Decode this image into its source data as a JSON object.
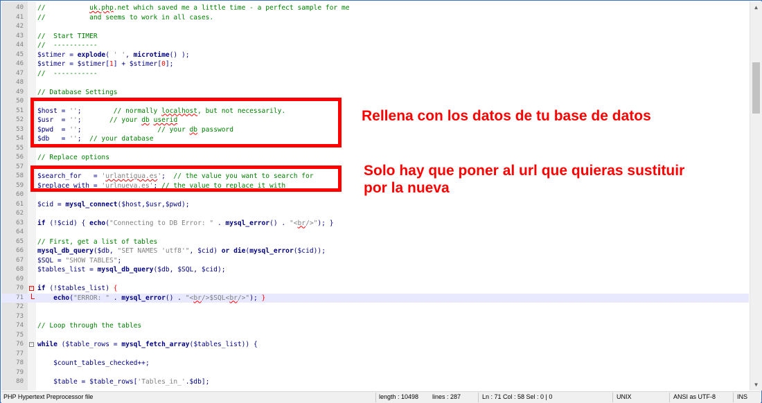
{
  "editor": {
    "lines": [
      {
        "num": "40",
        "parts": [
          [
            "c",
            "//           "
          ],
          [
            "c sq",
            "uk.php"
          ],
          [
            "c",
            ".net which saved me a little time - a perfect sample for me"
          ]
        ]
      },
      {
        "num": "41",
        "parts": [
          [
            "c",
            "//           and seems to work in all cases."
          ]
        ]
      },
      {
        "num": "42",
        "parts": []
      },
      {
        "num": "43",
        "parts": [
          [
            "c",
            "//  Start TIMER"
          ]
        ]
      },
      {
        "num": "44",
        "parts": [
          [
            "c",
            "//  -----------"
          ]
        ]
      },
      {
        "num": "45",
        "parts": [
          [
            "v",
            "$stimer"
          ],
          [
            "o",
            " = "
          ],
          [
            "f",
            "explode"
          ],
          [
            "o",
            "( "
          ],
          [
            "s",
            "' '"
          ],
          [
            "o",
            ", "
          ],
          [
            "f",
            "microtime"
          ],
          [
            "o",
            "() );"
          ]
        ]
      },
      {
        "num": "46",
        "parts": [
          [
            "v",
            "$stimer"
          ],
          [
            "o",
            " = "
          ],
          [
            "v",
            "$stimer"
          ],
          [
            "o",
            "["
          ],
          [
            "n",
            "1"
          ],
          [
            "o",
            "] + "
          ],
          [
            "v",
            "$stimer"
          ],
          [
            "o",
            "["
          ],
          [
            "n",
            "0"
          ],
          [
            "o",
            "];"
          ]
        ]
      },
      {
        "num": "47",
        "parts": [
          [
            "c",
            "//  -----------"
          ]
        ]
      },
      {
        "num": "48",
        "parts": []
      },
      {
        "num": "49",
        "parts": [
          [
            "c",
            "// Database Settings"
          ]
        ]
      },
      {
        "num": "50",
        "parts": []
      },
      {
        "num": "51",
        "parts": [
          [
            "v",
            "$host"
          ],
          [
            "o",
            " = "
          ],
          [
            "s",
            "''"
          ],
          [
            "o",
            ";        "
          ],
          [
            "c",
            "// normally "
          ],
          [
            "c sq",
            "localhost"
          ],
          [
            "c",
            ", but not necessarily."
          ]
        ]
      },
      {
        "num": "52",
        "parts": [
          [
            "v",
            "$usr"
          ],
          [
            "o",
            "  = "
          ],
          [
            "s",
            "''"
          ],
          [
            "o",
            ";       "
          ],
          [
            "c",
            "// your "
          ],
          [
            "c sq",
            "db"
          ],
          [
            "c",
            " "
          ],
          [
            "c sq",
            "userid"
          ]
        ]
      },
      {
        "num": "53",
        "parts": [
          [
            "v",
            "$pwd"
          ],
          [
            "o",
            "  = "
          ],
          [
            "s",
            "''"
          ],
          [
            "o",
            ";                   "
          ],
          [
            "c",
            "// your "
          ],
          [
            "c sq",
            "db"
          ],
          [
            "c",
            " password"
          ]
        ]
      },
      {
        "num": "54",
        "parts": [
          [
            "v",
            "$db"
          ],
          [
            "o",
            "   = "
          ],
          [
            "s",
            "''"
          ],
          [
            "o",
            ";  "
          ],
          [
            "c",
            "// your database"
          ]
        ]
      },
      {
        "num": "55",
        "parts": []
      },
      {
        "num": "56",
        "parts": [
          [
            "c",
            "// Replace options"
          ]
        ]
      },
      {
        "num": "57",
        "parts": []
      },
      {
        "num": "58",
        "parts": [
          [
            "v",
            "$search_for"
          ],
          [
            "o",
            "   = "
          ],
          [
            "s",
            "'"
          ],
          [
            "s sq",
            "urlantigua.es"
          ],
          [
            "s",
            "'"
          ],
          [
            "o",
            ";  "
          ],
          [
            "c",
            "// the value you want to search for"
          ]
        ]
      },
      {
        "num": "59",
        "parts": [
          [
            "v",
            "$replace_with"
          ],
          [
            "o",
            " = "
          ],
          [
            "s",
            "'"
          ],
          [
            "s sq",
            "urlnueva.es"
          ],
          [
            "s",
            "'"
          ],
          [
            "o",
            "; "
          ],
          [
            "c",
            "// the value to replace it with"
          ]
        ]
      },
      {
        "num": "60",
        "parts": []
      },
      {
        "num": "61",
        "parts": [
          [
            "v",
            "$cid"
          ],
          [
            "o",
            " = "
          ],
          [
            "f",
            "mysql_connect"
          ],
          [
            "o",
            "("
          ],
          [
            "v",
            "$host"
          ],
          [
            "o",
            ","
          ],
          [
            "v",
            "$usr"
          ],
          [
            "o",
            ","
          ],
          [
            "v",
            "$pwd"
          ],
          [
            "o",
            ");"
          ]
        ]
      },
      {
        "num": "62",
        "parts": []
      },
      {
        "num": "63",
        "parts": [
          [
            "k",
            "if"
          ],
          [
            "o",
            " (!"
          ],
          [
            "v",
            "$cid"
          ],
          [
            "o",
            ") { "
          ],
          [
            "f",
            "echo"
          ],
          [
            "o",
            "("
          ],
          [
            "s",
            "\"Connecting to DB Error: \""
          ],
          [
            "o",
            " . "
          ],
          [
            "f",
            "mysql_error"
          ],
          [
            "o",
            "() . "
          ],
          [
            "s",
            "\"<"
          ],
          [
            "s sq",
            "br"
          ],
          [
            "s",
            "/>\""
          ],
          [
            "o",
            "); }"
          ]
        ]
      },
      {
        "num": "64",
        "parts": []
      },
      {
        "num": "65",
        "parts": [
          [
            "c",
            "// First, get a list of tables"
          ]
        ]
      },
      {
        "num": "66",
        "parts": [
          [
            "f",
            "mysql_db_query"
          ],
          [
            "o",
            "("
          ],
          [
            "v",
            "$db"
          ],
          [
            "o",
            ", "
          ],
          [
            "s",
            "\"SET NAMES 'utf8'\""
          ],
          [
            "o",
            ", "
          ],
          [
            "v",
            "$cid"
          ],
          [
            "o",
            ") "
          ],
          [
            "k",
            "or"
          ],
          [
            "o",
            " "
          ],
          [
            "f",
            "die"
          ],
          [
            "o",
            "("
          ],
          [
            "f",
            "mysql_error"
          ],
          [
            "o",
            "("
          ],
          [
            "v",
            "$cid"
          ],
          [
            "o",
            "));"
          ]
        ]
      },
      {
        "num": "67",
        "parts": [
          [
            "v",
            "$SQL"
          ],
          [
            "o",
            " = "
          ],
          [
            "s",
            "\"SHOW TABLES\""
          ],
          [
            "o",
            ";"
          ]
        ]
      },
      {
        "num": "68",
        "parts": [
          [
            "v",
            "$tables_list"
          ],
          [
            "o",
            " = "
          ],
          [
            "f",
            "mysql_db_query"
          ],
          [
            "o",
            "("
          ],
          [
            "v",
            "$db"
          ],
          [
            "o",
            ", "
          ],
          [
            "v",
            "$SQL"
          ],
          [
            "o",
            ", "
          ],
          [
            "v",
            "$cid"
          ],
          [
            "o",
            ");"
          ]
        ]
      },
      {
        "num": "69",
        "parts": []
      },
      {
        "num": "70",
        "parts": [
          [
            "k",
            "if"
          ],
          [
            "o",
            " (!"
          ],
          [
            "v",
            "$tables_list"
          ],
          [
            "o",
            ") "
          ],
          [
            "br",
            "{"
          ]
        ]
      },
      {
        "num": "71",
        "parts": [
          [
            "o",
            "    "
          ],
          [
            "f",
            "echo"
          ],
          [
            "o",
            "("
          ],
          [
            "s",
            "\"ERROR: \""
          ],
          [
            "o",
            " . "
          ],
          [
            "f",
            "mysql_error"
          ],
          [
            "o",
            "() . "
          ],
          [
            "s",
            "\"<"
          ],
          [
            "s sq",
            "br"
          ],
          [
            "s",
            "/>$SQL<"
          ],
          [
            "s sq",
            "br"
          ],
          [
            "s",
            "/>\""
          ],
          [
            "o",
            "); "
          ],
          [
            "br",
            "}"
          ]
        ]
      },
      {
        "num": "72",
        "parts": []
      },
      {
        "num": "73",
        "parts": []
      },
      {
        "num": "74",
        "parts": [
          [
            "c",
            "// Loop through the tables"
          ]
        ]
      },
      {
        "num": "75",
        "parts": []
      },
      {
        "num": "76",
        "parts": [
          [
            "k",
            "while"
          ],
          [
            "o",
            " ("
          ],
          [
            "v",
            "$table_rows"
          ],
          [
            "o",
            " = "
          ],
          [
            "f",
            "mysql_fetch_array"
          ],
          [
            "o",
            "("
          ],
          [
            "v",
            "$tables_list"
          ],
          [
            "o",
            ")) {"
          ]
        ]
      },
      {
        "num": "77",
        "parts": []
      },
      {
        "num": "78",
        "parts": [
          [
            "o",
            "    "
          ],
          [
            "v",
            "$count_tables_checked"
          ],
          [
            "o",
            "++;"
          ]
        ]
      },
      {
        "num": "79",
        "parts": []
      },
      {
        "num": "80",
        "parts": [
          [
            "o",
            "    "
          ],
          [
            "v",
            "$table"
          ],
          [
            "o",
            " = "
          ],
          [
            "v",
            "$table_rows"
          ],
          [
            "o",
            "["
          ],
          [
            "s",
            "'Tables_in_'"
          ],
          [
            "o",
            "."
          ],
          [
            "v",
            "$db"
          ],
          [
            "o",
            "];"
          ]
        ]
      }
    ]
  },
  "scrollbar": {
    "up_icon": "▲",
    "down_icon": "▼"
  },
  "annotations": {
    "note1": "Rellena con los datos de tu base de datos",
    "note2_line1": "Solo hay que poner al url que quieras sustituir",
    "note2_line2": "por la nueva",
    "color": "#ff0000"
  },
  "statusbar": {
    "filetype": "PHP Hypertext Preprocessor file",
    "length": "length : 10498",
    "lines": "lines : 287",
    "position": "Ln : 71    Col : 58    Sel : 0 | 0",
    "eol": "UNIX",
    "encoding": "ANSI as UTF-8",
    "mode": "INS"
  }
}
